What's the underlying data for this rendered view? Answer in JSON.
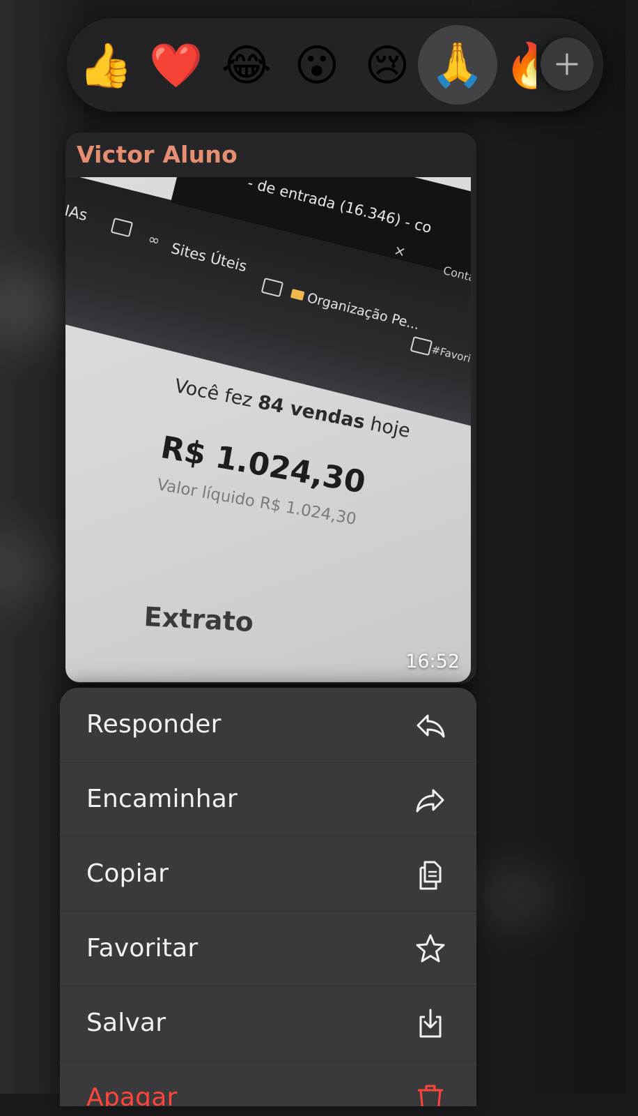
{
  "reactions": [
    {
      "emoji": "👍",
      "name": "thumbs-up"
    },
    {
      "emoji": "❤️",
      "name": "red-heart"
    },
    {
      "emoji": "😂",
      "name": "tears-of-joy"
    },
    {
      "emoji": "😮",
      "name": "open-mouth"
    },
    {
      "emoji": "😢",
      "name": "crying-face"
    },
    {
      "emoji": "🙏",
      "name": "folded-hands",
      "selected": true
    },
    {
      "emoji": "🔥",
      "name": "fire"
    }
  ],
  "message": {
    "sender": "Victor Aluno",
    "time": "16:52",
    "photo": {
      "tab_title": "- de entrada (16.346) - co",
      "tab_close": "×",
      "tab_right": "Conta",
      "bookmark_prefix": "IAs",
      "bookmark_sites": "Sites Úteis",
      "bookmark_org": "Organização Pe...",
      "bookmark_fav": "#Favorit",
      "sales_prefix": "Você fez ",
      "sales_count": "84 vendas",
      "sales_suffix": " hoje",
      "amount": "R$ 1.024,30",
      "net_value": "Valor líquido R$ 1.024,30",
      "statement": "Extrato"
    }
  },
  "menu": [
    {
      "label": "Responder",
      "icon": "reply-icon"
    },
    {
      "label": "Encaminhar",
      "icon": "forward-icon"
    },
    {
      "label": "Copiar",
      "icon": "copy-icon"
    },
    {
      "label": "Favoritar",
      "icon": "star-icon"
    },
    {
      "label": "Salvar",
      "icon": "save-icon"
    },
    {
      "label": "Apagar",
      "icon": "trash-icon"
    }
  ],
  "colors": {
    "sender": "#e58e71",
    "danger": "#ff453a",
    "menu_bg": "#3a3a3c"
  }
}
